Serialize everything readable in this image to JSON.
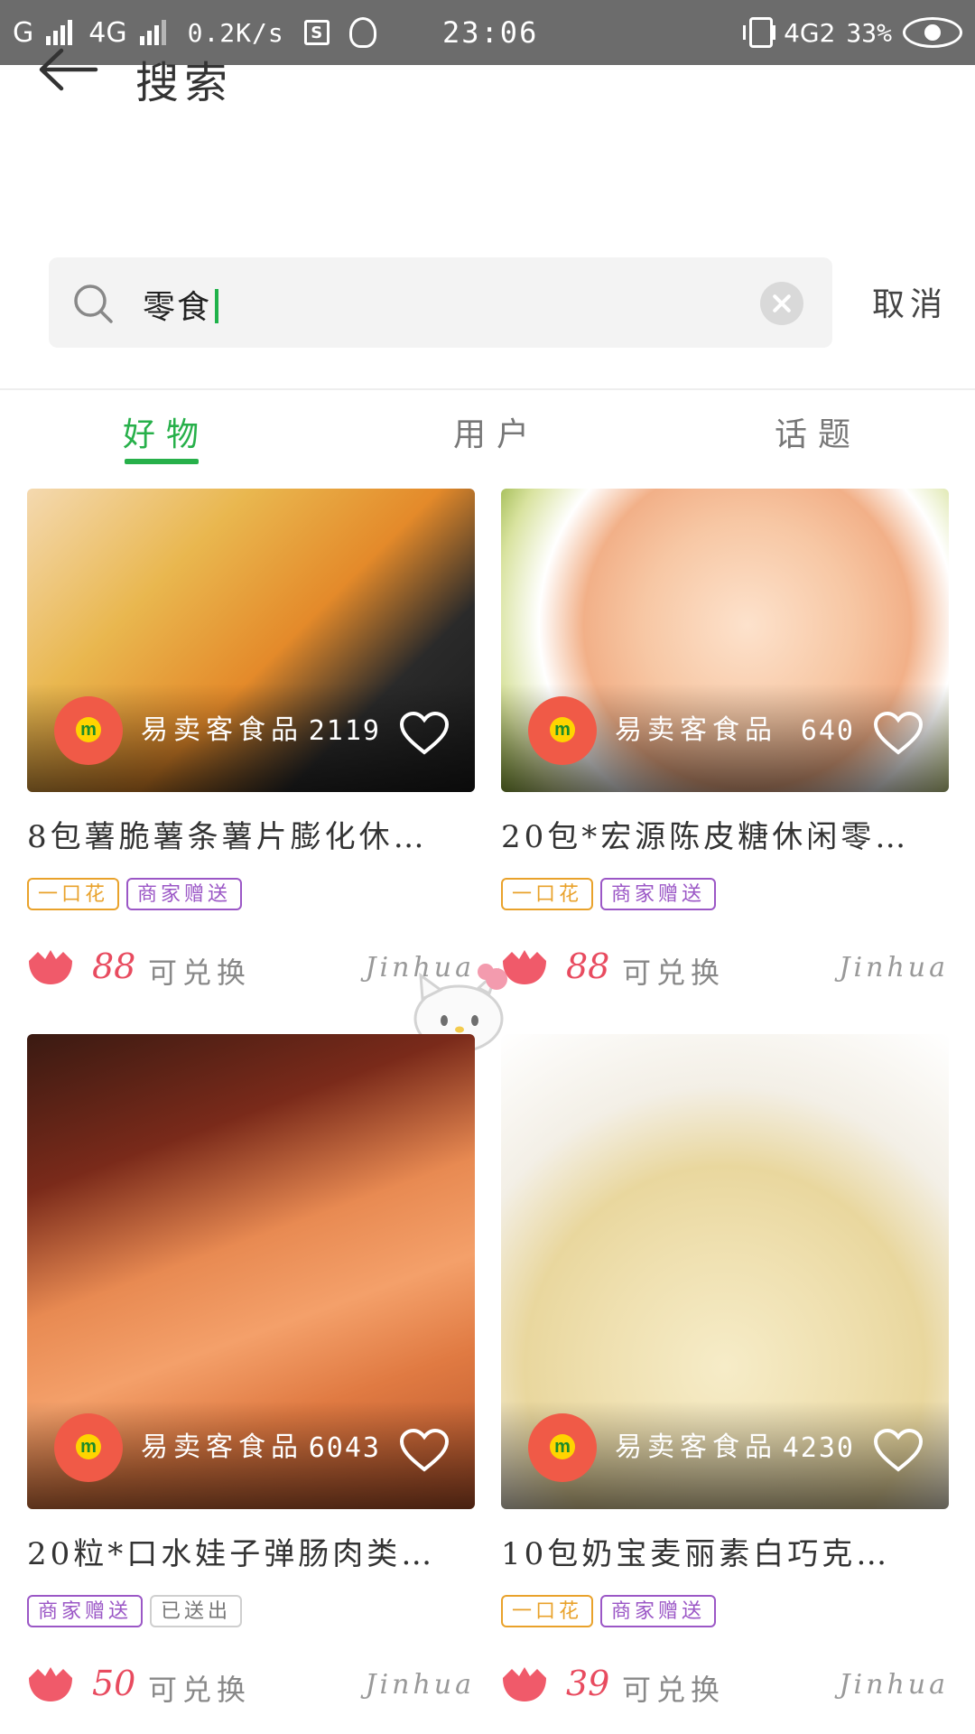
{
  "status_bar": {
    "network_left": "G",
    "network_4g": "4G",
    "speed": "0.2K/s",
    "time": "23:06",
    "network_right": "4G2",
    "battery": "33%"
  },
  "header": {
    "title": "搜索"
  },
  "search": {
    "value": "零食",
    "cancel_label": "取消"
  },
  "tabs": [
    {
      "label": "好物",
      "active": true
    },
    {
      "label": "用户",
      "active": false
    },
    {
      "label": "话题",
      "active": false
    }
  ],
  "colors": {
    "accent": "#27b04a",
    "points": "#e84b5f",
    "tag_orange": "#e9a22b",
    "tag_purple": "#9b57c6"
  },
  "products": [
    {
      "shop": "易卖客食品",
      "likes": "2119",
      "title": "8包薯脆薯条薯片膨化休…",
      "tags": [
        "一口花",
        "商家赠送"
      ],
      "points": "88",
      "exchange": "可兑换",
      "owner": "Jinhua"
    },
    {
      "shop": "易卖客食品",
      "likes": "640",
      "title": "20包*宏源陈皮糖休闲零…",
      "tags": [
        "一口花",
        "商家赠送"
      ],
      "points": "88",
      "exchange": "可兑换",
      "owner": "Jinhua"
    },
    {
      "shop": "易卖客食品",
      "likes": "6043",
      "title": "20粒*口水娃子弹肠肉类…",
      "tags": [
        "商家赠送",
        "已送出"
      ],
      "points": "50",
      "exchange": "可兑换",
      "owner": "Jinhua"
    },
    {
      "shop": "易卖客食品",
      "likes": "4230",
      "title": "10包奶宝麦丽素白巧克…",
      "tags": [
        "一口花",
        "商家赠送"
      ],
      "points": "39",
      "exchange": "可兑换",
      "owner": "Jinhua"
    }
  ]
}
